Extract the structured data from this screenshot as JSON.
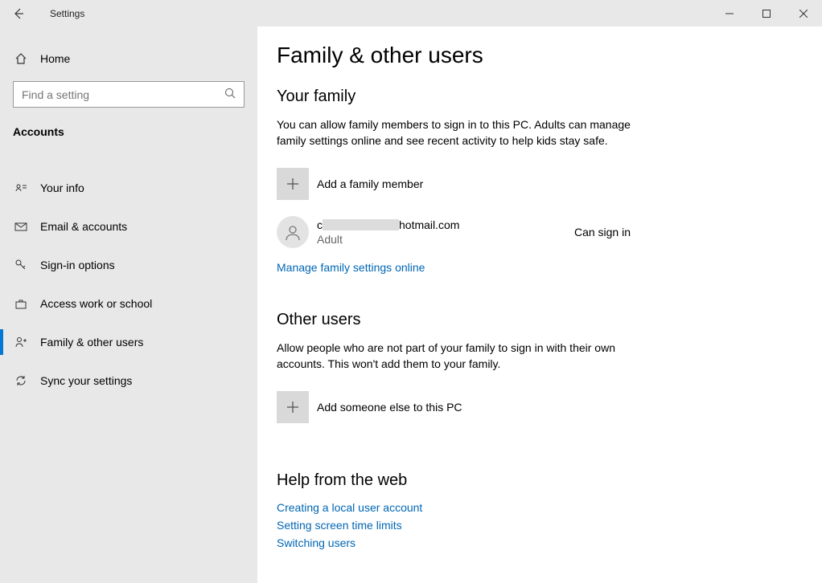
{
  "titlebar": {
    "title": "Settings"
  },
  "sidebar": {
    "home_label": "Home",
    "search_placeholder": "Find a setting",
    "category": "Accounts",
    "items": [
      {
        "label": "Your info"
      },
      {
        "label": "Email & accounts"
      },
      {
        "label": "Sign-in options"
      },
      {
        "label": "Access work or school"
      },
      {
        "label": "Family & other users"
      },
      {
        "label": "Sync your settings"
      }
    ]
  },
  "content": {
    "page_title": "Family & other users",
    "family": {
      "heading": "Your family",
      "desc": "You can allow family members to sign in to this PC. Adults can manage family settings online and see recent activity to help kids stay safe.",
      "add_label": "Add a family member",
      "user": {
        "email_prefix": "c",
        "email_suffix": "hotmail.com",
        "role": "Adult",
        "status": "Can sign in"
      },
      "manage_link": "Manage family settings online"
    },
    "other": {
      "heading": "Other users",
      "desc": "Allow people who are not part of your family to sign in with their own accounts. This won't add them to your family.",
      "add_label": "Add someone else to this PC"
    },
    "help": {
      "heading": "Help from the web",
      "links": [
        "Creating a local user account",
        "Setting screen time limits",
        "Switching users"
      ]
    }
  }
}
